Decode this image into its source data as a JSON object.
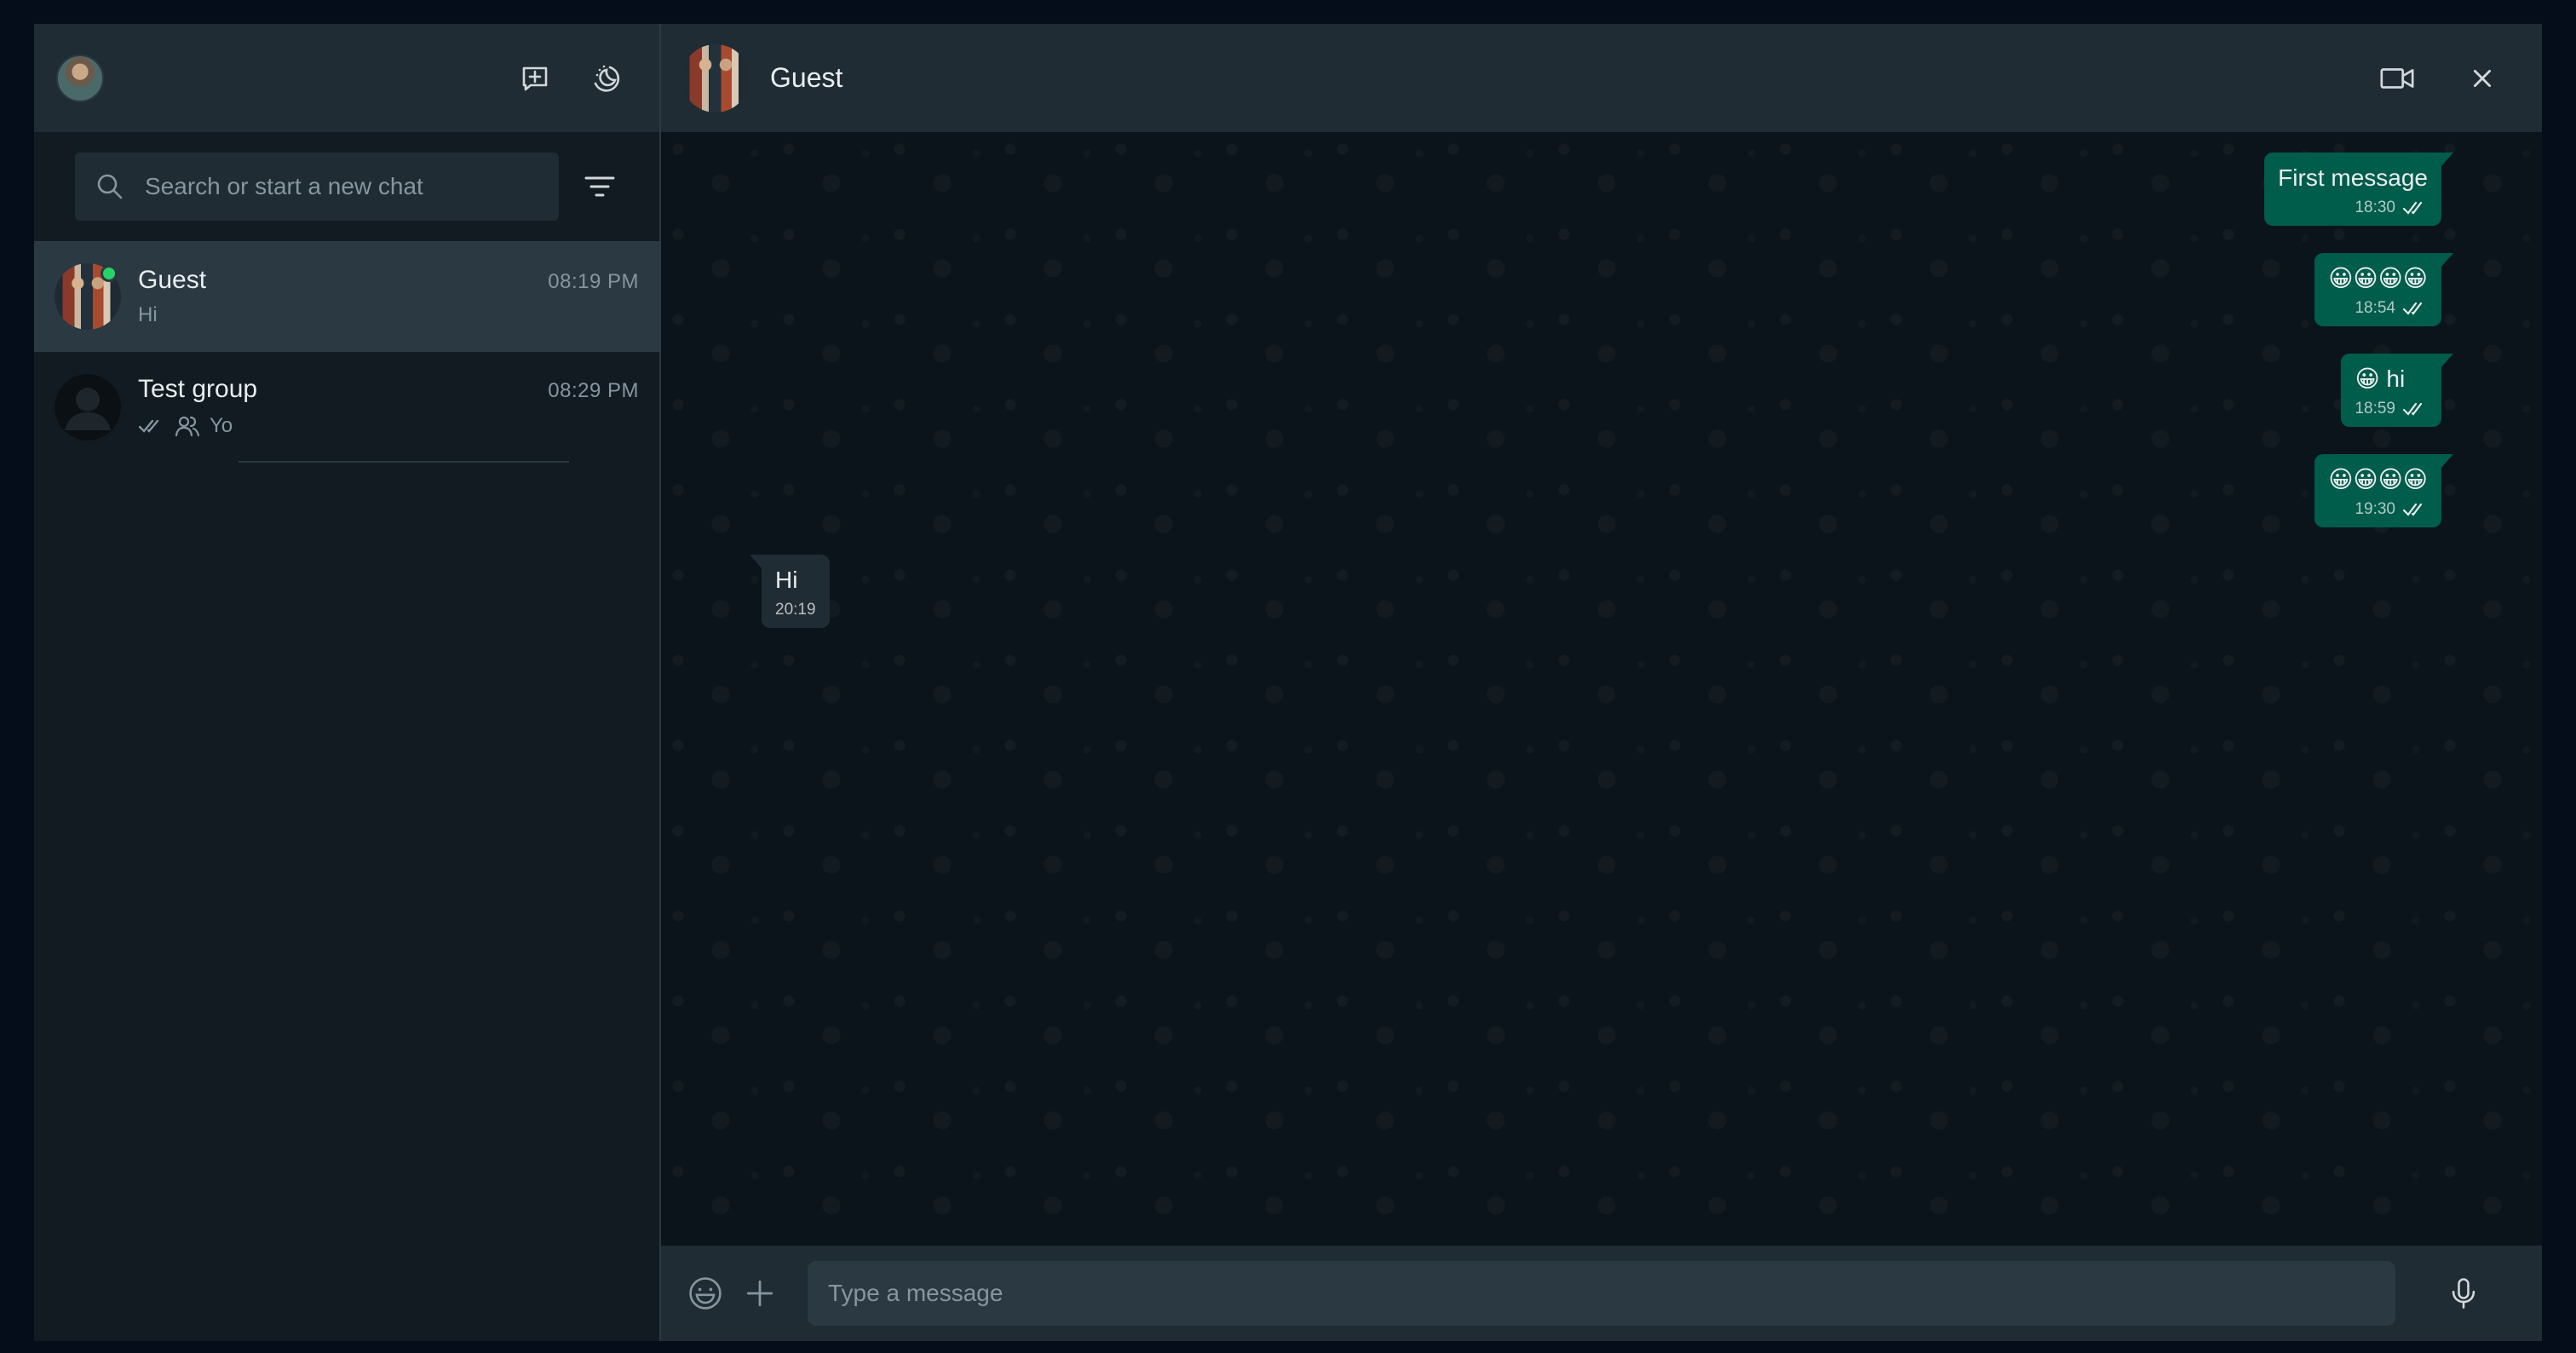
{
  "colors": {
    "panel": "#202c33",
    "background": "#111b21",
    "outgoing_bubble": "#005c4b",
    "incoming_bubble": "#202c33",
    "online": "#25d366"
  },
  "sidebar": {
    "header_icons": [
      "new-chat-icon",
      "status-icon"
    ],
    "search": {
      "placeholder": "Search or start a new chat",
      "value": ""
    },
    "filter_icon": "filter-icon",
    "chats": [
      {
        "name": "Guest",
        "time": "08:19 PM",
        "preview": "Hi",
        "online": true,
        "active": true
      },
      {
        "name": "Test group",
        "time": "08:29 PM",
        "preview": "Yo",
        "preview_icons": [
          "double-check-icon",
          "group-icon"
        ],
        "online": false,
        "active": false
      }
    ]
  },
  "conversation": {
    "contact_name": "Guest",
    "header_icons": [
      "video-call-icon",
      "close-icon"
    ],
    "messages": [
      {
        "direction": "out",
        "text": "First message",
        "time": "18:30",
        "status": "read"
      },
      {
        "direction": "out",
        "text": "😀😀😀😀",
        "time": "18:54",
        "status": "read"
      },
      {
        "direction": "out",
        "text": "😀 hi",
        "time": "18:59",
        "status": "read"
      },
      {
        "direction": "out",
        "text": "😀😀😀😀",
        "time": "19:30",
        "status": "read"
      },
      {
        "direction": "in",
        "text": "Hi",
        "time": "20:19"
      }
    ],
    "composer": {
      "placeholder": "Type a message",
      "value": "",
      "icons": [
        "emoji-icon",
        "attach-icon",
        "mic-icon"
      ]
    }
  }
}
